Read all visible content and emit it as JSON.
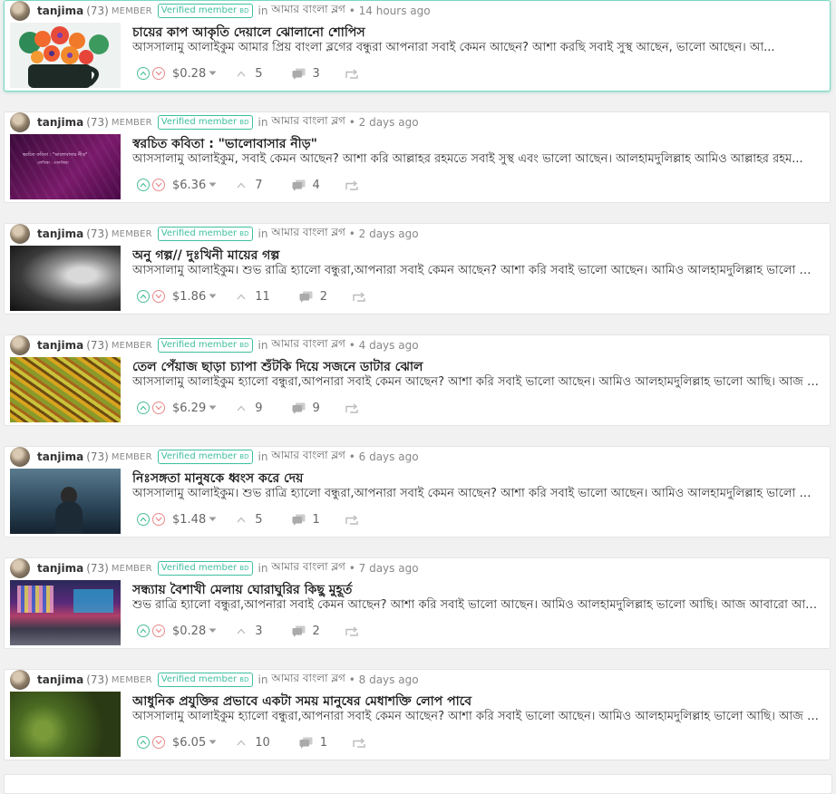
{
  "posts": [
    {
      "author": "tanjima",
      "reputation": "(73)",
      "role": "MEMBER",
      "badge": "Verified member",
      "badge_suffix": "BD",
      "in_word": "in",
      "community": "আমার বাংলা ব্লগ",
      "dot": "•",
      "time": "14 hours ago",
      "title": "চায়ের কাপ আকৃতি দেয়ালে ঝোলানো শোপিস",
      "summary": "আসসালামু আলাইকুম আমার প্রিয় বাংলা ব্লগের বন্ধুরা আপনারা সবাই কেমন আছেন? আশা করছি সবাই সুস্থ আছেন, ভালো আছেন। আ...",
      "payout": "$0.28",
      "votes": "5",
      "comments": "3",
      "thumb": "flowers"
    },
    {
      "author": "tanjima",
      "reputation": "(73)",
      "role": "MEMBER",
      "badge": "Verified member",
      "badge_suffix": "BD",
      "in_word": "in",
      "community": "আমার বাংলা ব্লগ",
      "dot": "•",
      "time": "2 days ago",
      "title": "স্বরচিত কবিতা : \"ভালোবাসার নীড়\"",
      "summary": "আসসালামু আলাইকুম, সবাই কেমন আছেন? আশা করি আল্লাহর রহমতে সবাই সুস্থ এবং ভালো আছেন। আলহামদুলিল্লাহ আমিও আল্লাহর রহম...",
      "payout": "$6.36",
      "votes": "7",
      "comments": "4",
      "thumb": "poem",
      "thumb_text_1": "স্বরচিত কবিতা : \"ভালোবাসার নীড়\"",
      "thumb_text_2": "লেখিকা : তানজিমা"
    },
    {
      "author": "tanjima",
      "reputation": "(73)",
      "role": "MEMBER",
      "badge": "Verified member",
      "badge_suffix": "BD",
      "in_word": "in",
      "community": "আমার বাংলা ব্লগ",
      "dot": "•",
      "time": "2 days ago",
      "title": "অনু গল্প// দুঃখিনী মায়ের গল্প",
      "summary": "আসসালামু আলাইকুম। শুভ রাত্রি হ্যালো বন্ধুরা,আপনারা সবাই কেমন আছেন? আশা করি সবাই ভালো আছেন। আমিও আলহামদুলিল্লাহ ভালো আছি।...",
      "payout": "$1.86",
      "votes": "11",
      "comments": "2",
      "thumb": "oldwoman"
    },
    {
      "author": "tanjima",
      "reputation": "(73)",
      "role": "MEMBER",
      "badge": "Verified member",
      "badge_suffix": "BD",
      "in_word": "in",
      "community": "আমার বাংলা ব্লগ",
      "dot": "•",
      "time": "4 days ago",
      "title": "তেল পেঁয়াজ ছাড়া চ্যাপা শুঁটকি দিয়ে সজনে ডাটার ঝোল",
      "summary": "আসসালামু আলাইকুম হ্যালো বন্ধুরা,আপনারা সবাই কেমন আছেন? আশা করি সবাই ভালো আছেন। আমিও আলহামদুলিল্লাহ ভালো আছি। আজ আবারো...",
      "payout": "$6.29",
      "votes": "9",
      "comments": "9",
      "thumb": "food"
    },
    {
      "author": "tanjima",
      "reputation": "(73)",
      "role": "MEMBER",
      "badge": "Verified member",
      "badge_suffix": "BD",
      "in_word": "in",
      "community": "আমার বাংলা ব্লগ",
      "dot": "•",
      "time": "6 days ago",
      "title": "নিঃসঙ্গতা মানুষকে ধ্বংস করে দেয়",
      "summary": "আসসালামু আলাইকুম। শুভ রাত্রি হ্যালো বন্ধুরা,আপনারা সবাই কেমন আছেন? আশা করি সবাই ভালো আছেন। আমিও আলহামদুলিল্লাহ ভালো আছি।...",
      "payout": "$1.48",
      "votes": "5",
      "comments": "1",
      "thumb": "lonely"
    },
    {
      "author": "tanjima",
      "reputation": "(73)",
      "role": "MEMBER",
      "badge": "Verified member",
      "badge_suffix": "BD",
      "in_word": "in",
      "community": "আমার বাংলা ব্লগ",
      "dot": "•",
      "time": "7 days ago",
      "title": "সন্ধ্যায় বৈশাখী মেলায় ঘোরাঘুরির কিছু মুহূর্ত",
      "summary": "শুভ রাত্রি হ্যালো বন্ধুরা,আপনারা সবাই কেমন আছেন? আশা করি সবাই ভালো আছেন। আমিও আলহামদুলিল্লাহ ভালো আছি। আজ আবারো আপনাদের...",
      "payout": "$0.28",
      "votes": "3",
      "comments": "2",
      "thumb": "fair"
    },
    {
      "author": "tanjima",
      "reputation": "(73)",
      "role": "MEMBER",
      "badge": "Verified member",
      "badge_suffix": "BD",
      "in_word": "in",
      "community": "আমার বাংলা ব্লগ",
      "dot": "•",
      "time": "8 days ago",
      "title": "আধুনিক প্রযুক্তির প্রভাবে একটা সময় মানুষের মেধাশক্তি লোপ পাবে",
      "summary": "আসসালামু আলাইকুম হ্যালো বন্ধুরা,আপনারা সবাই কেমন আছেন? আশা করি সবাই ভালো আছেন। আমিও আলহামদুলিল্লাহ ভালো আছি। আজ আবারো...",
      "payout": "$6.05",
      "votes": "10",
      "comments": "1",
      "thumb": "plants"
    }
  ],
  "colors": {
    "upvote": "#4cbf9a",
    "downvote": "#e88a8a",
    "badge": "#3fbf9f",
    "active_border": "#7ad9c3"
  },
  "icons": {
    "upvote": "chevron-up-circle-icon",
    "downvote": "chevron-down-circle-icon",
    "payout_menu": "caret-down-icon",
    "voters": "chevron-up-icon",
    "comments": "comments-icon",
    "resteem": "resteem-icon"
  }
}
